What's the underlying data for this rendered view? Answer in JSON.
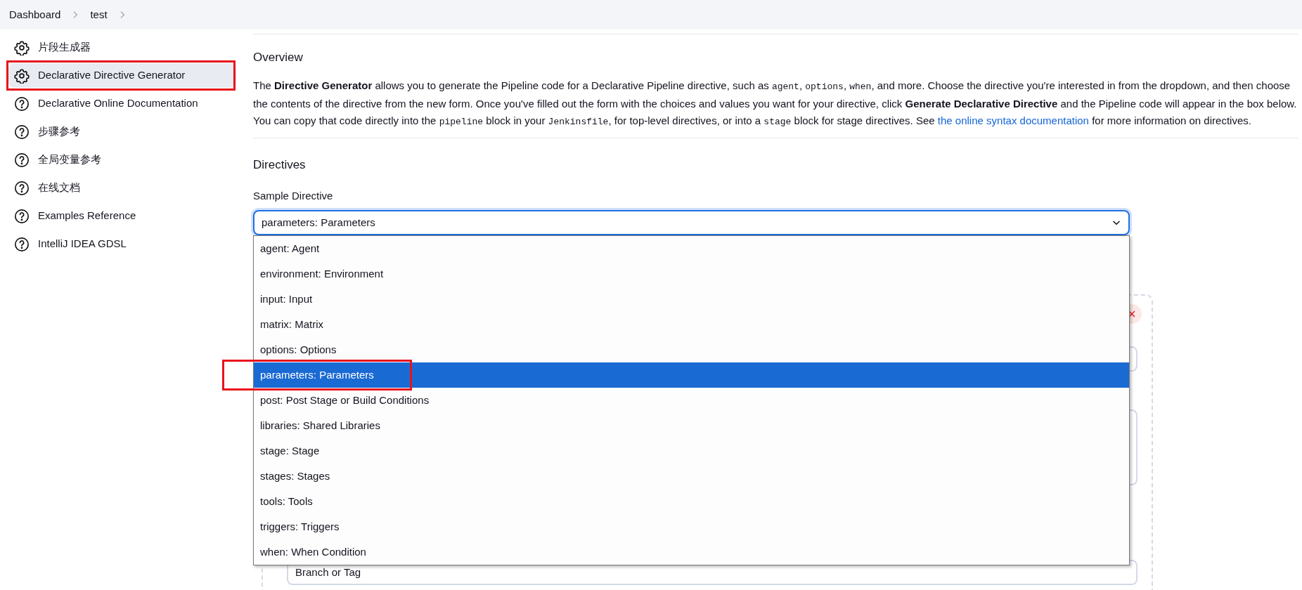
{
  "breadcrumb": [
    {
      "label": "Dashboard"
    },
    {
      "label": "test"
    }
  ],
  "sidebar": {
    "items": [
      {
        "label": "片段生成器",
        "kind": "gear",
        "selected": false,
        "annotated": false
      },
      {
        "label": "Declarative Directive Generator",
        "kind": "gear",
        "selected": true,
        "annotated": true
      },
      {
        "label": "Declarative Online Documentation",
        "kind": "help",
        "selected": false,
        "annotated": false
      },
      {
        "label": "步骤参考",
        "kind": "help",
        "selected": false,
        "annotated": false
      },
      {
        "label": "全局变量参考",
        "kind": "help",
        "selected": false,
        "annotated": false
      },
      {
        "label": "在线文档",
        "kind": "help",
        "selected": false,
        "annotated": false
      },
      {
        "label": "Examples Reference",
        "kind": "help",
        "selected": false,
        "annotated": false
      },
      {
        "label": "IntelliJ IDEA GDSL",
        "kind": "help",
        "selected": false,
        "annotated": false
      }
    ]
  },
  "overview": {
    "heading": "Overview",
    "paragraph": [
      {
        "kind": "text",
        "text": "The "
      },
      {
        "kind": "bold",
        "text": "Directive Generator"
      },
      {
        "kind": "text",
        "text": " allows you to generate the Pipeline code for a Declarative Pipeline directive, such as "
      },
      {
        "kind": "code",
        "text": "agent"
      },
      {
        "kind": "text",
        "text": ", "
      },
      {
        "kind": "code",
        "text": "options"
      },
      {
        "kind": "text",
        "text": ", "
      },
      {
        "kind": "code",
        "text": "when"
      },
      {
        "kind": "text",
        "text": ", and more. Choose the directive you're interested in from the dropdown, and then choose the contents of the directive from the new form. Once you've filled out the form with the choices and values you want for your directive, click "
      },
      {
        "kind": "bold",
        "text": "Generate Declarative Directive"
      },
      {
        "kind": "text",
        "text": " and the Pipeline code will appear in the box below. You can copy that code directly into the "
      },
      {
        "kind": "code",
        "text": "pipeline"
      },
      {
        "kind": "text",
        "text": " block in your "
      },
      {
        "kind": "code",
        "text": "Jenkinsfile"
      },
      {
        "kind": "text",
        "text": ", for top-level directives, or into a "
      },
      {
        "kind": "code",
        "text": "stage"
      },
      {
        "kind": "text",
        "text": " block for stage directives. See "
      },
      {
        "kind": "link",
        "text": "the online syntax documentation"
      },
      {
        "kind": "text",
        "text": " for more information on directives."
      }
    ]
  },
  "directives": {
    "heading": "Directives",
    "label": "Sample Directive",
    "value": "parameters: Parameters",
    "options": [
      {
        "label": "agent: Agent",
        "selected": false,
        "annotated": false
      },
      {
        "label": "environment: Environment",
        "selected": false,
        "annotated": false
      },
      {
        "label": "input: Input",
        "selected": false,
        "annotated": false
      },
      {
        "label": "matrix: Matrix",
        "selected": false,
        "annotated": false
      },
      {
        "label": "options: Options",
        "selected": false,
        "annotated": false
      },
      {
        "label": "parameters: Parameters",
        "selected": true,
        "annotated": true
      },
      {
        "label": "post: Post Stage or Build Conditions",
        "selected": false,
        "annotated": false
      },
      {
        "label": "libraries: Shared Libraries",
        "selected": false,
        "annotated": false
      },
      {
        "label": "stage: Stage",
        "selected": false,
        "annotated": false
      },
      {
        "label": "stages: Stages",
        "selected": false,
        "annotated": false
      },
      {
        "label": "tools: Tools",
        "selected": false,
        "annotated": false
      },
      {
        "label": "triggers: Triggers",
        "selected": false,
        "annotated": false
      },
      {
        "label": "when: When Condition",
        "selected": false,
        "annotated": false
      }
    ],
    "parameter_card": {
      "select_value": "Branch or Tag"
    }
  }
}
